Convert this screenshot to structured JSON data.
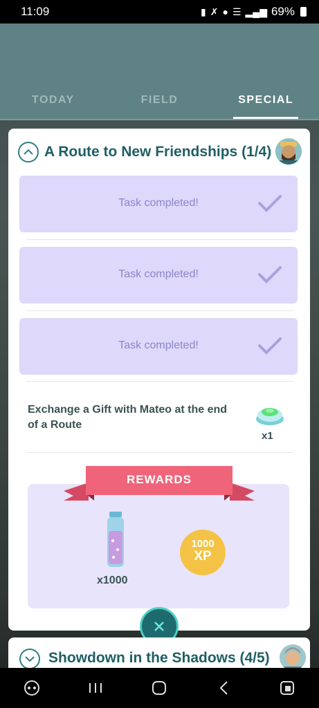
{
  "status": {
    "time": "11:09",
    "battery": "69%"
  },
  "tabs": [
    {
      "label": "TODAY",
      "active": false
    },
    {
      "label": "FIELD",
      "active": false
    },
    {
      "label": "SPECIAL",
      "active": true
    }
  ],
  "quest": {
    "title": "A Route to New Friendships (1/4)",
    "tasks": [
      {
        "text": "Task completed!",
        "completed": true
      },
      {
        "text": "Task completed!",
        "completed": true
      },
      {
        "text": "Task completed!",
        "completed": true
      }
    ],
    "open_task": {
      "text": "Exchange a Gift with Mateo at the end of a Route",
      "reward_icon": "incense-icon",
      "reward_count": "x1"
    },
    "rewards": {
      "label": "REWARDS",
      "items": [
        {
          "icon": "bottle-icon",
          "count": "x1000"
        },
        {
          "icon": "xp-badge",
          "amount": "1000",
          "unit": "XP"
        }
      ]
    }
  },
  "next_quest": {
    "title": "Showdown in the Shadows (4/5)"
  },
  "colors": {
    "header": "#5f8385",
    "task_bg": "#ded8fb",
    "rewards_bg": "#e8e4fb",
    "ribbon": "#f0647a",
    "title": "#1f5f64",
    "xp": "#f4c345",
    "close_btn": "#1e6b6f"
  }
}
